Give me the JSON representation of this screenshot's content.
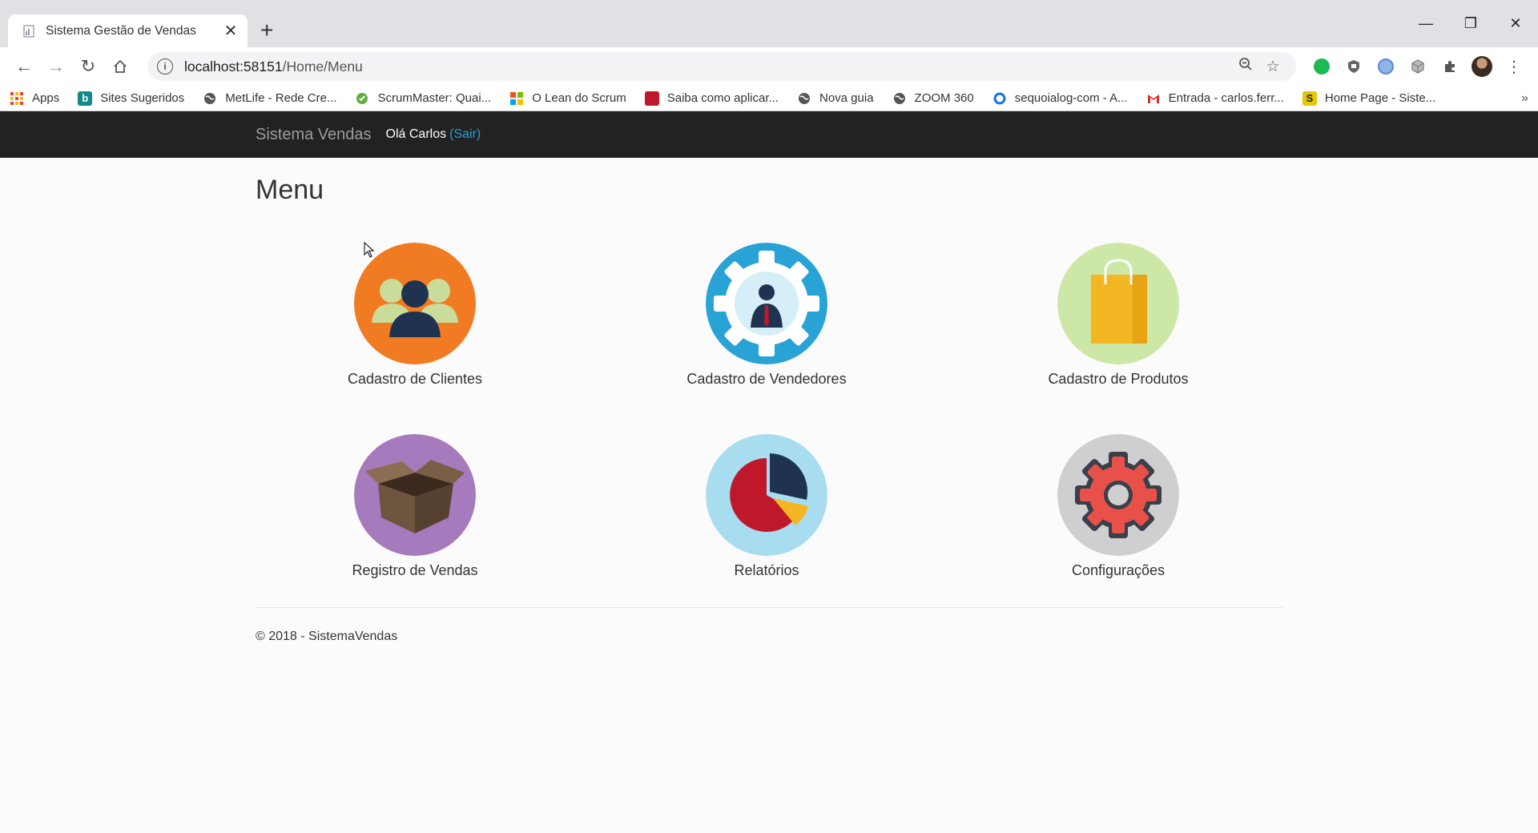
{
  "browser": {
    "tab_title": "Sistema Gestão de Vendas",
    "url_host": "localhost:58151",
    "url_path": "/Home/Menu",
    "bookmarks": [
      {
        "label": "Apps",
        "icon": "apps-grid-icon",
        "color": "#4285f4"
      },
      {
        "label": "Sites Sugeridos",
        "icon": "bing-icon",
        "color": "#138a8a"
      },
      {
        "label": "MetLife - Rede Cre...",
        "icon": "globe-icon",
        "color": "#555555"
      },
      {
        "label": "ScrumMaster: Quai...",
        "icon": "scrummaster-icon",
        "color": "#5fae3a"
      },
      {
        "label": "O Lean do Scrum",
        "icon": "microsoft-icon",
        "color": "#f25022"
      },
      {
        "label": "Saiba como aplicar...",
        "icon": "red-square-icon",
        "color": "#c0182b"
      },
      {
        "label": "Nova guia",
        "icon": "globe-icon",
        "color": "#555555"
      },
      {
        "label": "ZOOM 360",
        "icon": "globe-icon",
        "color": "#555555"
      },
      {
        "label": "sequoialog-com - A...",
        "icon": "circle-o-icon",
        "color": "#1a73e8"
      },
      {
        "label": "Entrada - carlos.ferr...",
        "icon": "gmail-icon",
        "color": "#d93025"
      },
      {
        "label": "Home Page - Siste...",
        "icon": "s-logo-icon",
        "color": "#e6c800"
      }
    ]
  },
  "navbar": {
    "brand": "Sistema Vendas",
    "greeting": "Olá Carlos",
    "logout": "(Sair)"
  },
  "page": {
    "title": "Menu",
    "tiles": [
      {
        "label": "Cadastro de Clientes",
        "icon": "clients-icon",
        "color": "#f07b23"
      },
      {
        "label": "Cadastro de Vendedores",
        "icon": "sellers-gear-icon",
        "color": "#29a3d6"
      },
      {
        "label": "Cadastro de Produtos",
        "icon": "shopping-bag-icon",
        "color": "#cde8a6"
      },
      {
        "label": "Registro de Vendas",
        "icon": "box-icon",
        "color": "#a67bbd"
      },
      {
        "label": "Relatórios",
        "icon": "pie-chart-icon",
        "color": "#a8ddef"
      },
      {
        "label": "Configurações",
        "icon": "gear-icon",
        "color": "#cfcfcf"
      }
    ],
    "footer": "© 2018 - SistemaVendas"
  }
}
